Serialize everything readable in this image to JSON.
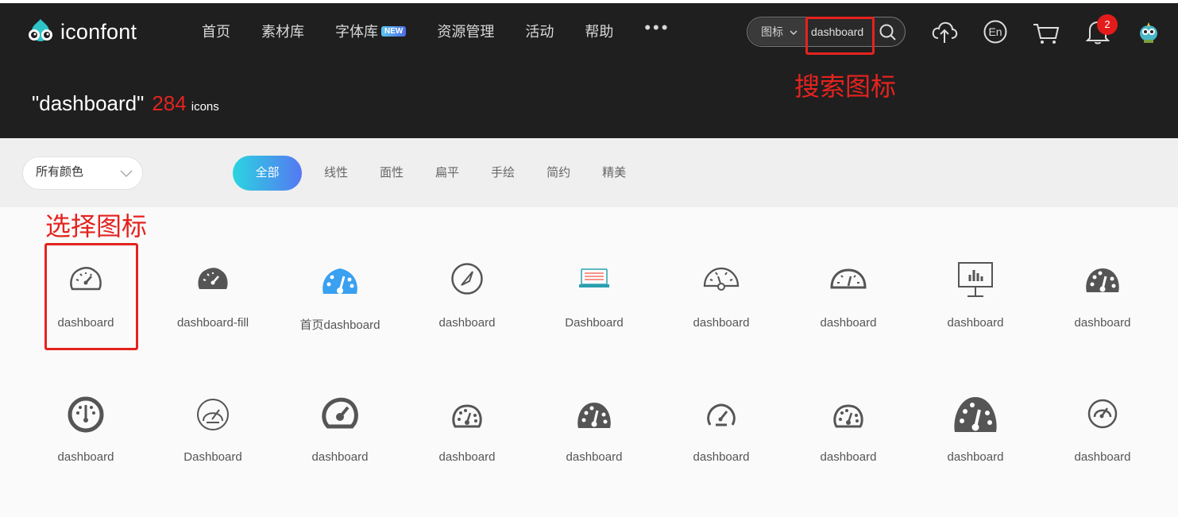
{
  "logo": {
    "text": "iconfont"
  },
  "nav": {
    "items": [
      "首页",
      "素材库",
      "字体库",
      "资源管理",
      "活动",
      "帮助"
    ],
    "badge": "NEW",
    "more": "•••"
  },
  "search": {
    "type": "图标",
    "value": "dashboard"
  },
  "notifications": {
    "count": "2"
  },
  "header_icons": [
    "upload-cloud-icon",
    "language-en-icon",
    "cart-icon",
    "bell-icon",
    "avatar"
  ],
  "lang_label": "En",
  "annotations": {
    "search": "搜索图标",
    "select": "选择图标"
  },
  "result": {
    "query": "\"dashboard\"",
    "count": "284",
    "unit": "icons"
  },
  "filters": {
    "color": "所有颜色",
    "tabs": [
      "全部",
      "线性",
      "面性",
      "扁平",
      "手绘",
      "简约",
      "精美"
    ]
  },
  "colors": {
    "accent_red": "#e4231f",
    "header_bg": "#1f1f1f",
    "icon_gray": "#555555",
    "icon_blue": "#3aa0f0"
  },
  "icons_row1": [
    {
      "name": "dashboard",
      "icon": "speedometer-outline-icon"
    },
    {
      "name": "dashboard-fill",
      "icon": "speedometer-fill-icon"
    },
    {
      "name": "首页dashboard",
      "icon": "speedometer-blue-icon"
    },
    {
      "name": "dashboard",
      "icon": "gauge-circle-icon"
    },
    {
      "name": "Dashboard",
      "icon": "laptop-icon"
    },
    {
      "name": "dashboard",
      "icon": "half-gauge-outline-icon"
    },
    {
      "name": "dashboard",
      "icon": "half-gauge-icon"
    },
    {
      "name": "dashboard",
      "icon": "presentation-chart-icon"
    },
    {
      "name": "dashboard",
      "icon": "speedometer-dots-icon"
    }
  ],
  "icons_row2": [
    {
      "name": "dashboard",
      "icon": "gauge-ring-icon"
    },
    {
      "name": "Dashboard",
      "icon": "gauge-thin-icon"
    },
    {
      "name": "dashboard",
      "icon": "gauge-bold-icon"
    },
    {
      "name": "dashboard",
      "icon": "gauge-dots-outline-icon"
    },
    {
      "name": "dashboard",
      "icon": "gauge-dots-fill-icon"
    },
    {
      "name": "dashboard",
      "icon": "gauge-arc-icon"
    },
    {
      "name": "dashboard",
      "icon": "gauge-dots-small-icon"
    },
    {
      "name": "dashboard",
      "icon": "gauge-large-fill-icon"
    },
    {
      "name": "dashboard",
      "icon": "gauge-ring-small-icon"
    }
  ]
}
